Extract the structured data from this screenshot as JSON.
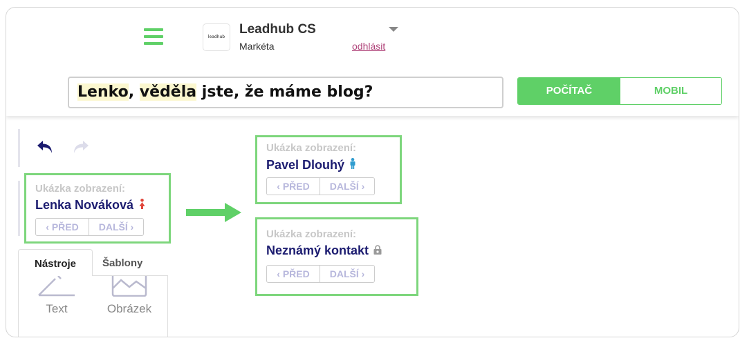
{
  "header": {
    "account_name": "Leadhub CS",
    "logo_text": "leadhub",
    "user_name": "Markéta",
    "logout_label": "odhlásit"
  },
  "subject": {
    "highlight_1": "Lenko",
    "sep": ", ",
    "highlight_2": "věděla",
    "rest": " jste, že máme blog?"
  },
  "device": {
    "desktop_label": "POČÍTAČ",
    "mobile_label": "MOBIL",
    "active": "desktop"
  },
  "previews": [
    {
      "label": "Ukázka zobrazení:",
      "name": "Lenka Nováková",
      "icon": "female-icon",
      "prev": "‹ PŘED",
      "next": "DALŠÍ ›"
    },
    {
      "label": "Ukázka zobrazení:",
      "name": "Pavel Dlouhý",
      "icon": "male-icon",
      "prev": "‹ PŘED",
      "next": "DALŠÍ ›"
    },
    {
      "label": "Ukázka zobrazení:",
      "name": "Neznámý kontakt",
      "icon": "unknown-contact-icon",
      "prev": "‹ PŘED",
      "next": "DALŠÍ ›"
    }
  ],
  "tabs": [
    {
      "label": "Nástroje",
      "active": true
    },
    {
      "label": "Šablony",
      "active": false
    }
  ],
  "tools": [
    {
      "label": "Text",
      "icon": "text-block-icon"
    },
    {
      "label": "Obrázek",
      "icon": "image-block-icon"
    }
  ],
  "colors": {
    "accent_green": "#5fd067",
    "preview_border": "#7dd67c",
    "name_navy": "#1c1c70",
    "logout_pink": "#b0447a",
    "female_red": "#e0453a",
    "male_blue": "#2f9ccf",
    "unknown_gray": "#9a9a9a"
  }
}
